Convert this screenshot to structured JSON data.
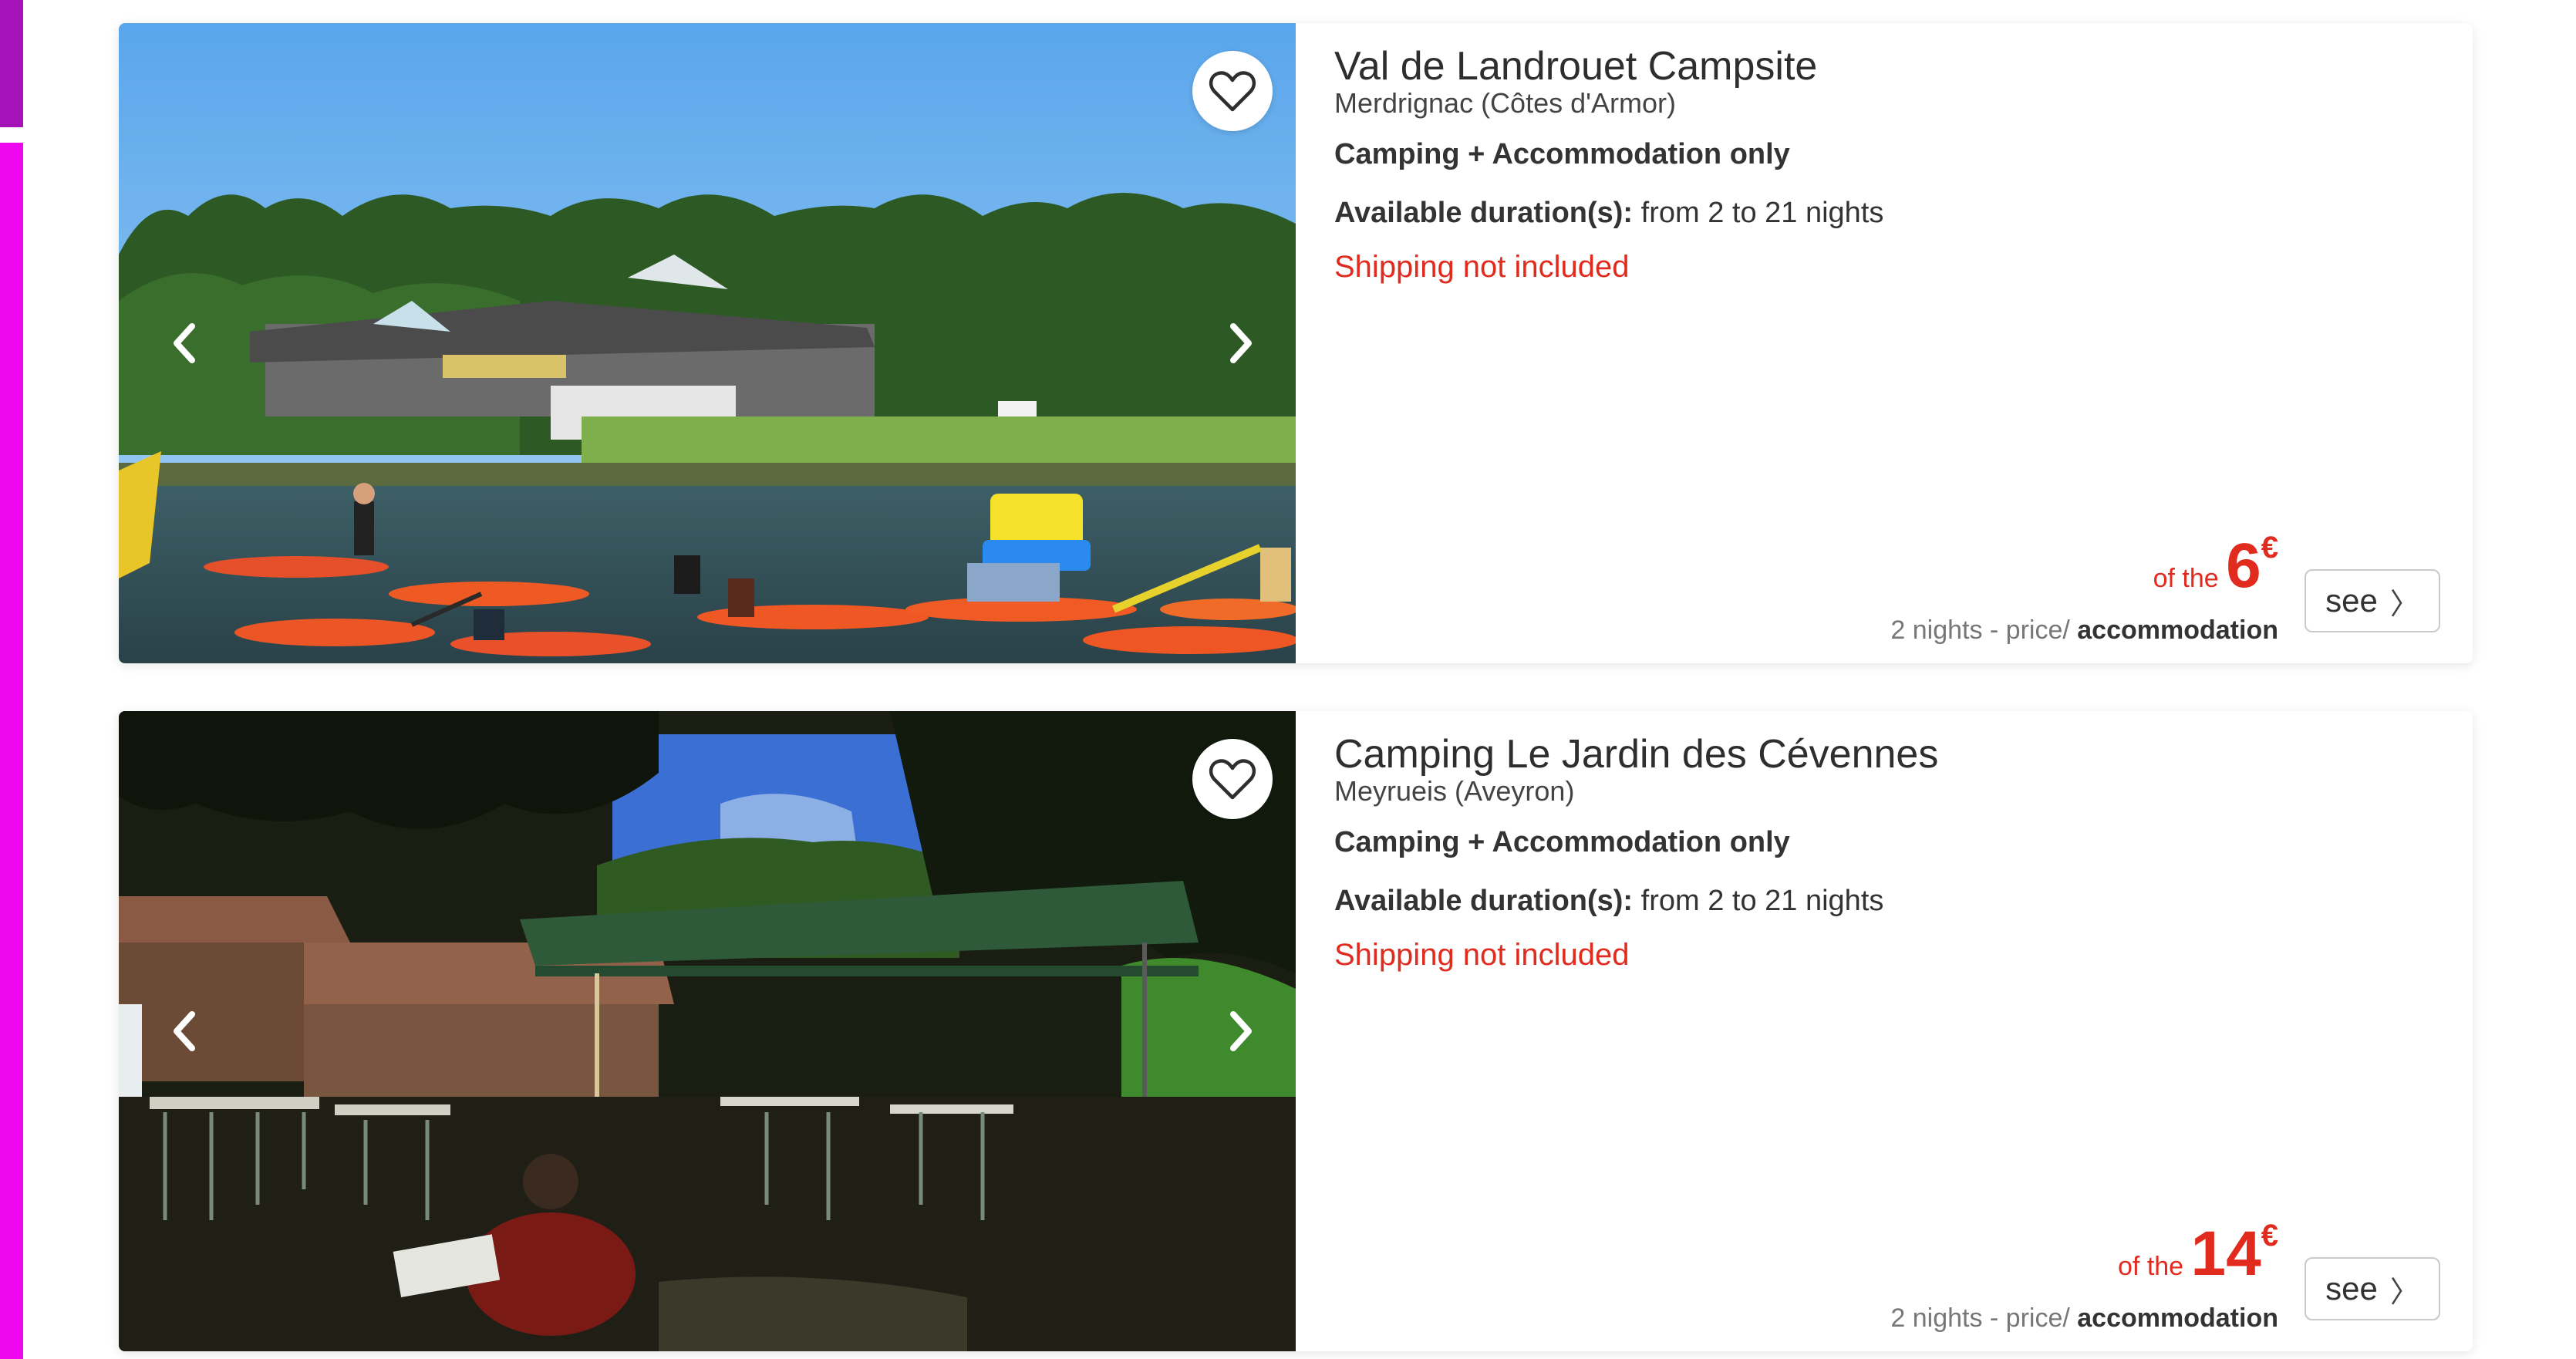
{
  "listings": [
    {
      "title": "Val de Landrouet Campsite",
      "location": "Merdrignac (Côtes d'Armor)",
      "offer_type": "Camping + Accommodation only",
      "duration_label": "Available duration(s):",
      "duration_value": " from 2 to 21 nights",
      "shipping": "Shipping not included",
      "price_prefix": "of the ",
      "price_value": "6",
      "price_currency": "€",
      "price_note_plain": "2 nights - price/",
      "price_note_bold": " accommodation",
      "see_label": "see",
      "see_chevron": "〉"
    },
    {
      "title": "Camping Le Jardin des Cévennes",
      "location": "Meyrueis (Aveyron)",
      "offer_type": "Camping + Accommodation only",
      "duration_label": "Available duration(s):",
      "duration_value": " from 2 to 21 nights",
      "shipping": "Shipping not included",
      "price_prefix": "of the ",
      "price_value": "14",
      "price_currency": "€",
      "price_note_plain": "2 nights - price/",
      "price_note_bold": " accommodation",
      "see_label": "see",
      "see_chevron": "〉"
    }
  ],
  "icons": {
    "favorite": "heart-outline-icon",
    "prev": "chevron-left-icon",
    "next": "chevron-right-icon"
  },
  "colors": {
    "accent_red": "#e02b1e",
    "side_bar_top": "#a512b8",
    "side_bar_bottom": "#ee08ee"
  }
}
